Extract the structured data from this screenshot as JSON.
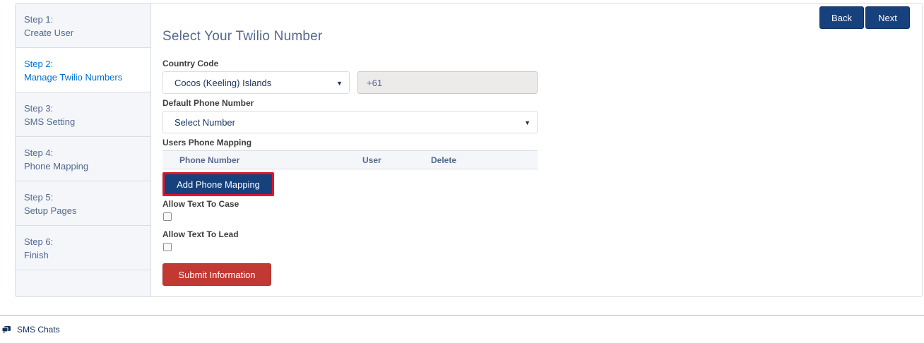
{
  "sidebar": {
    "steps": [
      {
        "line1": "Step 1:",
        "line2": "Create User"
      },
      {
        "line1": "Step 2:",
        "line2": "Manage Twilio Numbers"
      },
      {
        "line1": "Step 3:",
        "line2": "SMS Setting"
      },
      {
        "line1": "Step 4:",
        "line2": "Phone Mapping"
      },
      {
        "line1": "Step 5:",
        "line2": "Setup Pages"
      },
      {
        "line1": "Step 6:",
        "line2": "Finish"
      }
    ]
  },
  "header": {
    "title": "Select Your Twilio Number",
    "back_label": "Back",
    "next_label": "Next"
  },
  "form": {
    "country_code_label": "Country Code",
    "country_value": "Cocos (Keeling) Islands",
    "dial_code": "+61",
    "default_phone_label": "Default Phone Number",
    "default_phone_value": "Select Number",
    "mapping_label": "Users Phone Mapping",
    "mapping_columns": [
      "Phone Number",
      "User",
      "Delete"
    ],
    "add_mapping_label": "Add Phone Mapping",
    "allow_case_label": "Allow Text To Case",
    "allow_lead_label": "Allow Text To Lead",
    "submit_label": "Submit Information"
  },
  "footer": {
    "item_label": "SMS Chats",
    "item_icon": "chat-icon"
  },
  "colors": {
    "primary": "#16417d",
    "danger": "#c23934",
    "active_step": "#0070d2",
    "highlight_border": "#e0142b"
  }
}
